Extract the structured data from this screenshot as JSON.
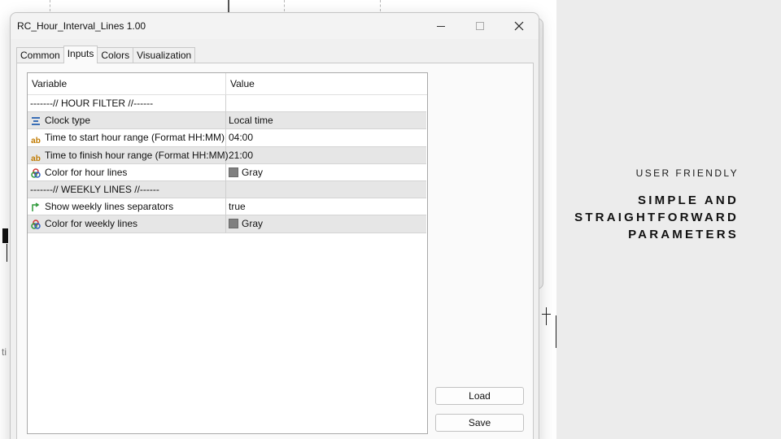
{
  "window": {
    "title": "RC_Hour_Interval_Lines 1.00"
  },
  "tabs": [
    {
      "label": "Common"
    },
    {
      "label": "Inputs"
    },
    {
      "label": "Colors"
    },
    {
      "label": "Visualization"
    }
  ],
  "grid": {
    "headers": {
      "variable": "Variable",
      "value": "Value"
    },
    "rows": [
      {
        "variable": "-------// HOUR FILTER //------",
        "value": "",
        "icon": "none"
      },
      {
        "variable": "Clock type",
        "value": "Local time",
        "icon": "enum-icon"
      },
      {
        "variable": "Time to start hour range (Format HH:MM)",
        "value": "04:00",
        "icon": "string-icon"
      },
      {
        "variable": "Time to finish hour range (Format HH:MM)",
        "value": "21:00",
        "icon": "string-icon"
      },
      {
        "variable": "Color for hour lines",
        "value": "Gray",
        "icon": "color-icon"
      },
      {
        "variable": "-------// WEEKLY LINES //------",
        "value": "",
        "icon": "none"
      },
      {
        "variable": "Show weekly lines separators",
        "value": "true",
        "icon": "bool-icon"
      },
      {
        "variable": "Color for weekly lines",
        "value": "Gray",
        "icon": "color-icon"
      }
    ]
  },
  "buttons": {
    "load": "Load",
    "save": "Save"
  },
  "side_panel": {
    "tag": "USER FRIENDLY",
    "headline": [
      "SIMPLE AND",
      "STRAIGHTFORWARD",
      "PARAMETERS"
    ]
  },
  "chart_partial_text": "ti",
  "colors": {
    "swatch_gray": "#808080",
    "side_panel_bg": "#ececec"
  }
}
